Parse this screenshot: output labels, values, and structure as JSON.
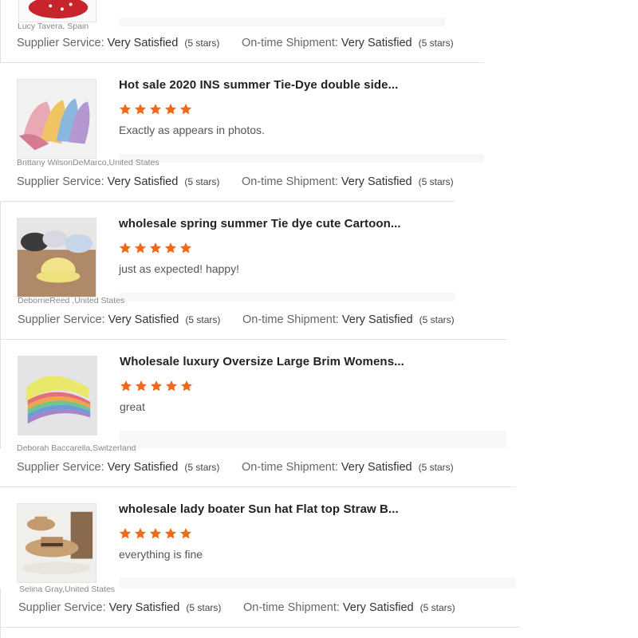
{
  "reviews": [
    {
      "thumb_icon": "red-bucket-hat-photo",
      "title": "",
      "comment": "",
      "buyer": "Lucy Tavera, Spain",
      "supplier_label": "Supplier Service:",
      "supplier_value": "Very Satisfied",
      "supplier_stars": "(5 stars)",
      "shipment_label": "On-time Shipment:",
      "shipment_value": "Very Satisfied",
      "shipment_stars": "(5 stars)"
    },
    {
      "thumb_icon": "tie-dye-bucket-hats-photo",
      "title": "Hot sale 2020 INS summer Tie-Dye double side...",
      "comment": "Exactly as appears in photos.",
      "buyer": "Brittany WilsonDeMarco,United States",
      "supplier_label": "Supplier Service:",
      "supplier_value": "Very Satisfied",
      "supplier_stars": "(5 stars)",
      "shipment_label": "On-time Shipment:",
      "shipment_value": "Very Satisfied",
      "shipment_stars": "(5 stars)"
    },
    {
      "thumb_icon": "cartoon-bucket-hats-photo",
      "title": "wholesale spring summer Tie dye cute Cartoon...",
      "comment": "just as expected! happy!",
      "buyer": "DeborrieReed ,United States",
      "supplier_label": "Supplier Service:",
      "supplier_value": "Very Satisfied",
      "supplier_stars": "(5 stars)",
      "shipment_label": "On-time Shipment:",
      "shipment_value": "Very Satisfied",
      "shipment_stars": "(5 stars)"
    },
    {
      "thumb_icon": "oversize-brim-hats-photo",
      "title": "Wholesale luxury Oversize Large Brim Womens...",
      "comment": "great",
      "buyer": "Deborah Baccarella,Switzerland",
      "supplier_label": "Supplier Service:",
      "supplier_value": "Very Satisfied",
      "supplier_stars": "(5 stars)",
      "shipment_label": "On-time Shipment:",
      "shipment_value": "Very Satisfied",
      "shipment_stars": "(5 stars)"
    },
    {
      "thumb_icon": "straw-boater-hats-photo",
      "title": "wholesale lady boater Sun hat Flat top Straw B...",
      "comment": "everything is fine",
      "buyer": "Selina Gray,United States",
      "supplier_label": "Supplier Service:",
      "supplier_value": "Very Satisfied",
      "supplier_stars": "(5 stars)",
      "shipment_label": "On-time Shipment:",
      "shipment_value": "Very Satisfied",
      "shipment_stars": "(5 stars)"
    }
  ],
  "star_rating": 5,
  "colors": {
    "star": "#f2681a",
    "divider": "#e2e2e2",
    "reply_strip": "#f7f7f8"
  }
}
